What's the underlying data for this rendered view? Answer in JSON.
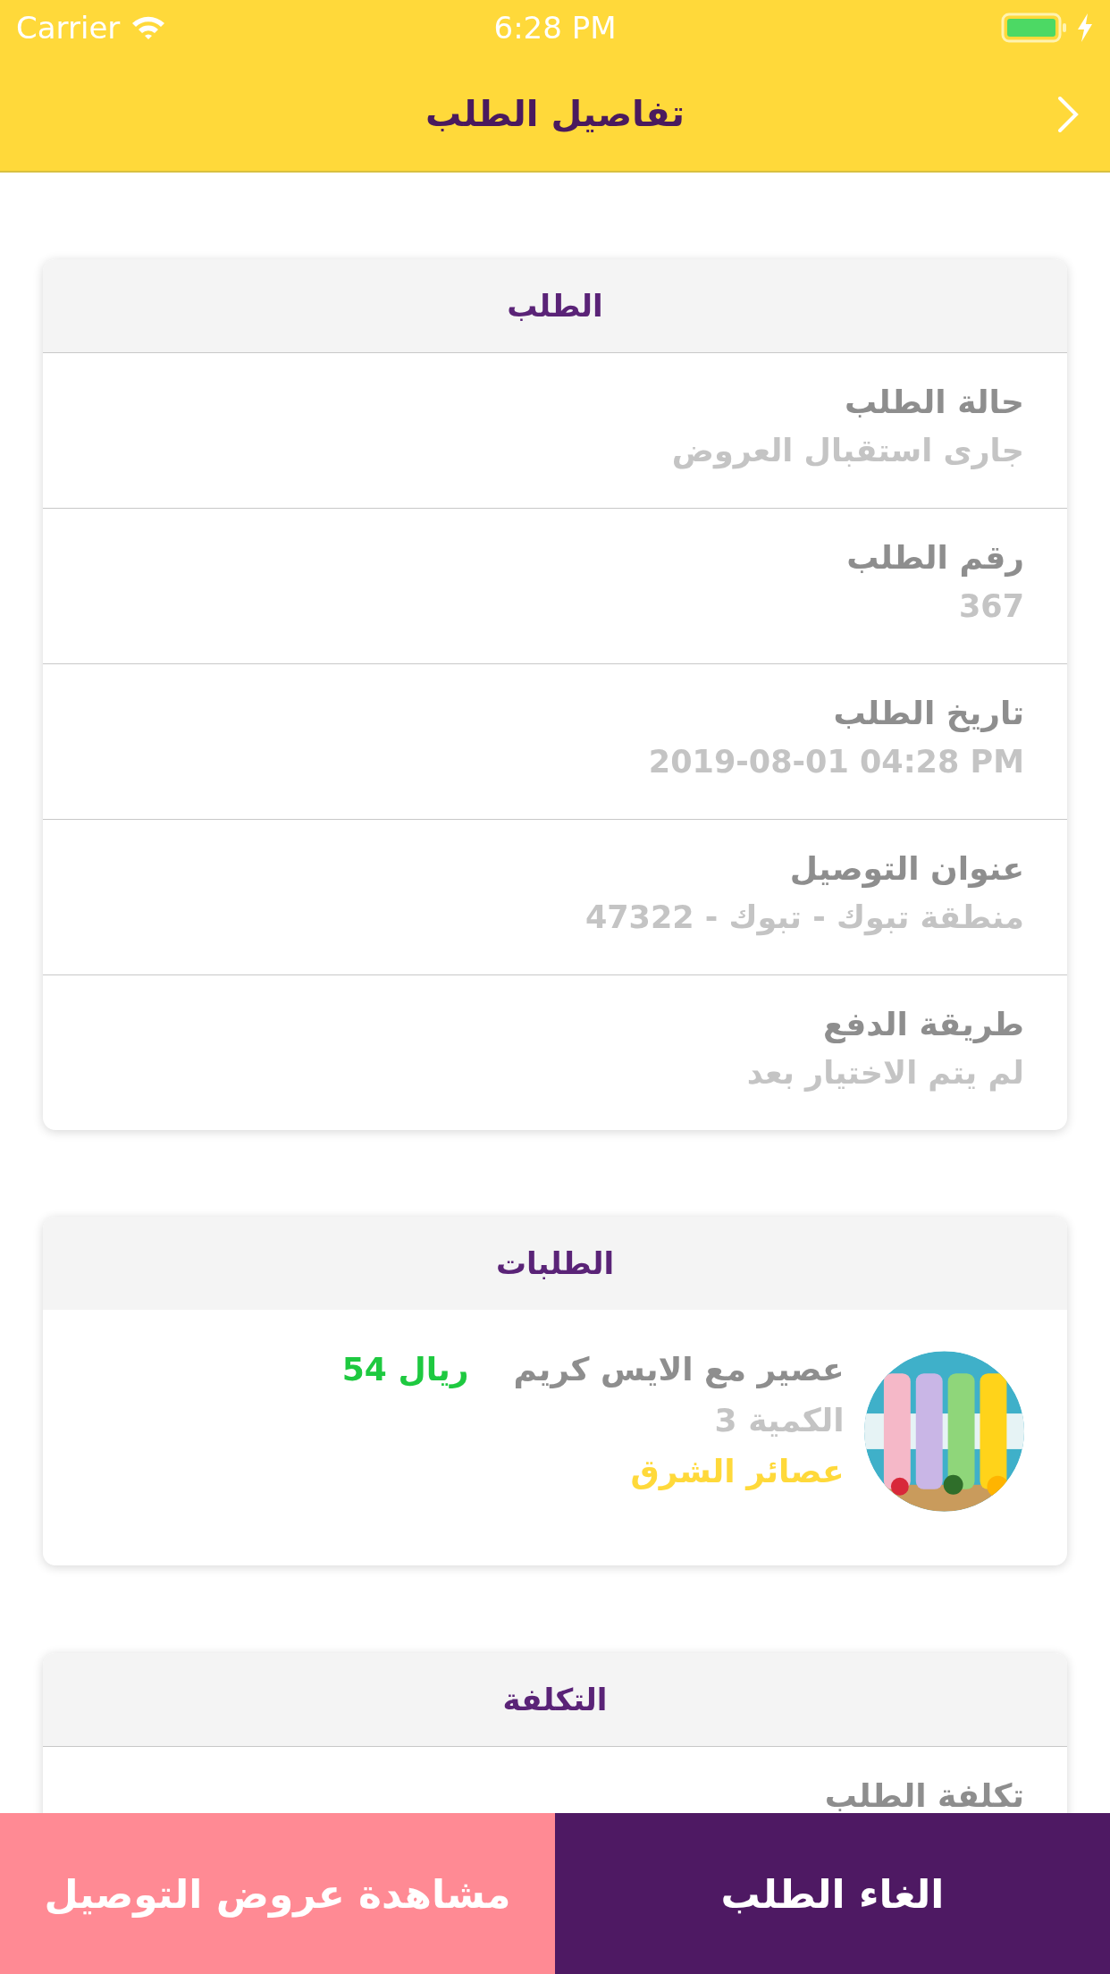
{
  "status_bar": {
    "carrier": "Carrier",
    "time": "6:28 PM"
  },
  "nav": {
    "title": "تفاصيل الطلب"
  },
  "order_card": {
    "title": "الطلب",
    "rows": [
      {
        "label": "حالة الطلب",
        "value": "جارى استقبال العروض"
      },
      {
        "label": "رقم الطلب",
        "value": "367"
      },
      {
        "label": "تاريخ الطلب",
        "value": "2019-08-01 04:28 PM"
      },
      {
        "label": "عنوان التوصيل",
        "value": "منطقة تبوك - تبوك - 47322"
      },
      {
        "label": "طريقة الدفع",
        "value": "لم يتم الاختيار بعد"
      }
    ]
  },
  "items_card": {
    "title": "الطلبات",
    "items": [
      {
        "name": "عصير مع الايس كريم",
        "price": "ريال 54",
        "quantity": "الكمية 3",
        "store": "عصائر الشرق"
      }
    ]
  },
  "cost_card": {
    "title": "التكلفة",
    "rows": [
      {
        "label": "تكلفة الطلب"
      }
    ]
  },
  "actions": [
    {
      "label": "الغاء الطلب",
      "kind": "primary"
    },
    {
      "label": "مشاهدة عروض التوصيل",
      "kind": "secondary"
    }
  ]
}
